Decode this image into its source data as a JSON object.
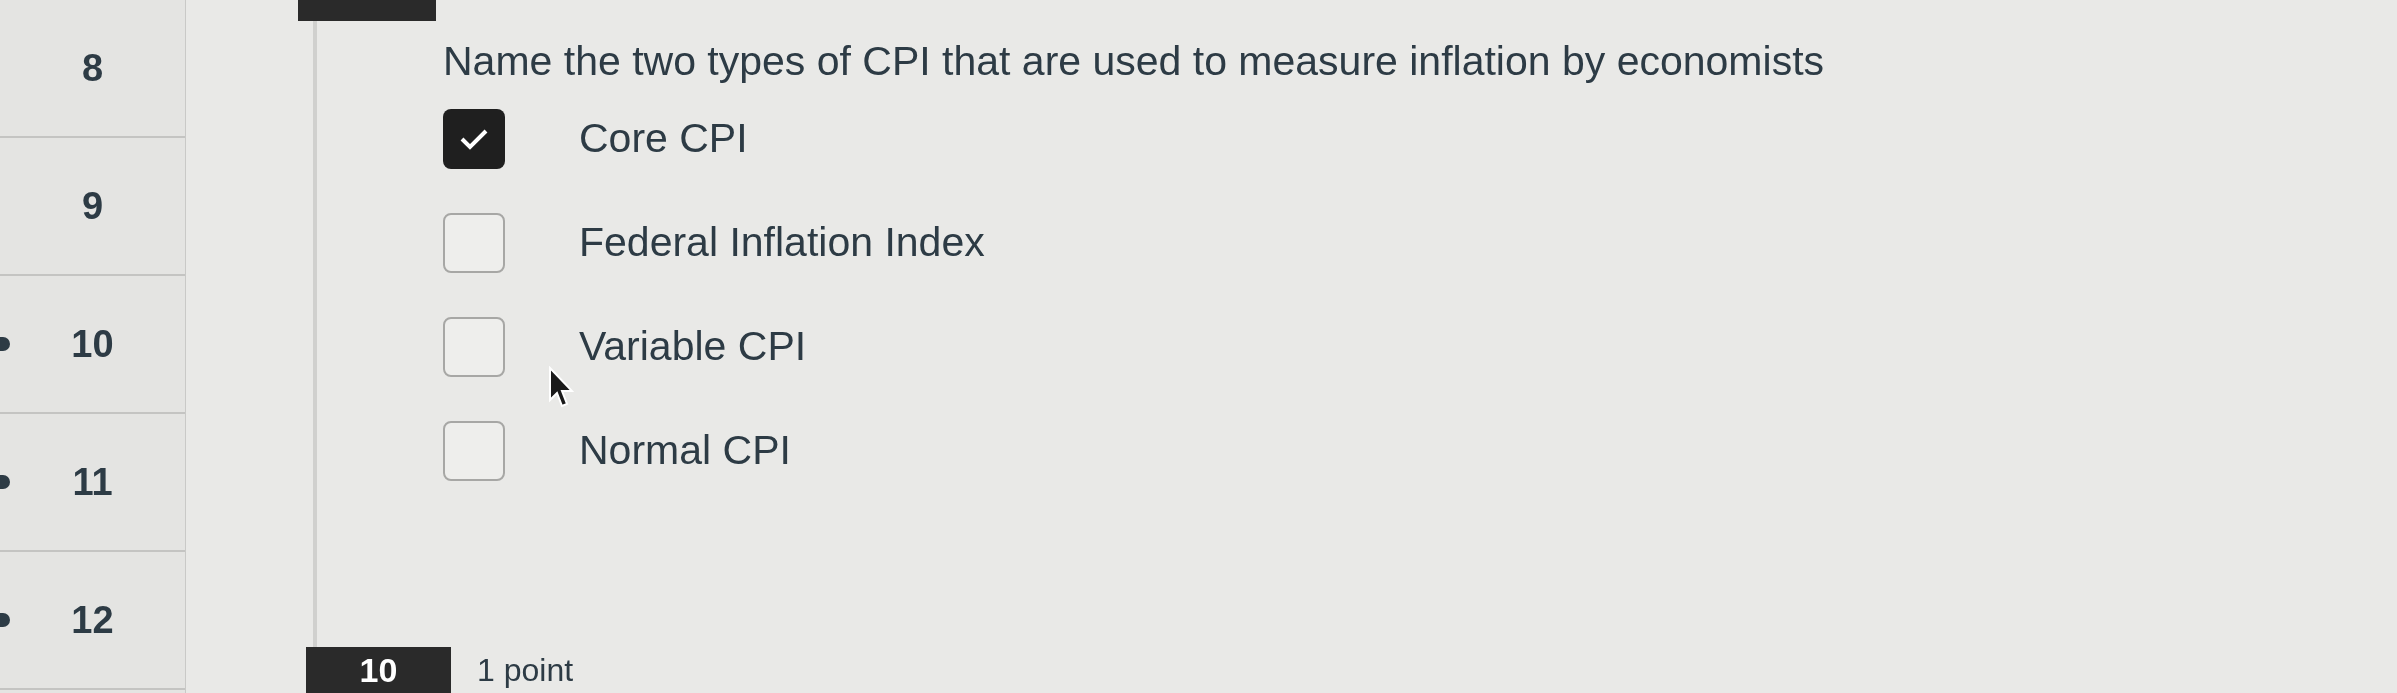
{
  "sidebar": {
    "items": [
      {
        "number": "8",
        "marked": false
      },
      {
        "number": "9",
        "marked": false
      },
      {
        "number": "10",
        "marked": true
      },
      {
        "number": "11",
        "marked": true
      },
      {
        "number": "12",
        "marked": true
      }
    ]
  },
  "question": {
    "text": "Name the two types of CPI that are used to measure inflation by economists",
    "options": [
      {
        "label": "Core CPI",
        "checked": true
      },
      {
        "label": "Federal Inflation Index",
        "checked": false
      },
      {
        "label": "Variable CPI",
        "checked": false
      },
      {
        "label": "Normal CPI",
        "checked": false
      }
    ]
  },
  "next_question": {
    "number": "10",
    "points": "1 point"
  }
}
